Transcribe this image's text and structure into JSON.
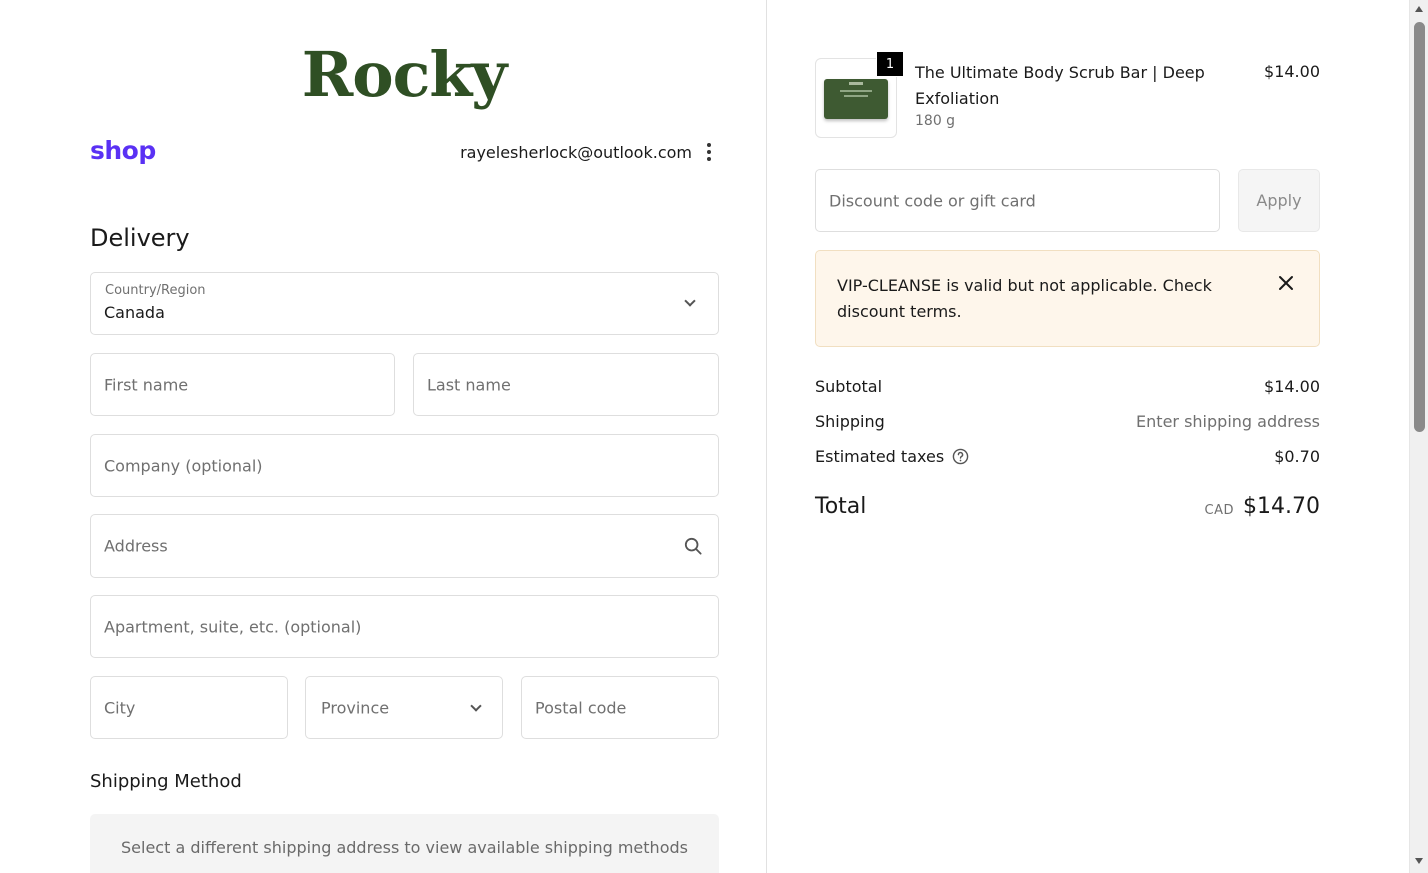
{
  "brand": {
    "logo_text": "Rocky",
    "shop_pay_text": "shop"
  },
  "account": {
    "email": "rayelesherlock@outlook.com"
  },
  "delivery": {
    "heading": "Delivery",
    "country_label": "Country/Region",
    "country_value": "Canada",
    "first_name_placeholder": "First name",
    "last_name_placeholder": "Last name",
    "company_placeholder": "Company (optional)",
    "address_placeholder": "Address",
    "apartment_placeholder": "Apartment, suite, etc. (optional)",
    "city_placeholder": "City",
    "province_placeholder": "Province",
    "postal_placeholder": "Postal code"
  },
  "shipping_method": {
    "heading": "Shipping Method",
    "note": "Select a different shipping address to view available shipping methods"
  },
  "cart": {
    "item": {
      "quantity": "1",
      "name": "The Ultimate Body Scrub Bar | Deep Exfoliation",
      "variant": "180 g",
      "price": "$14.00"
    },
    "discount_placeholder": "Discount code or gift card",
    "apply_label": "Apply",
    "notice_text": "VIP-CLEANSE is valid but not applicable. Check discount terms.",
    "summary": {
      "subtotal_label": "Subtotal",
      "subtotal_value": "$14.00",
      "shipping_label": "Shipping",
      "shipping_value": "Enter shipping address",
      "taxes_label": "Estimated taxes",
      "taxes_value": "$0.70",
      "total_label": "Total",
      "total_currency": "CAD",
      "total_value": "$14.70"
    }
  },
  "colors": {
    "brand_green": "#2f4f24",
    "shop_purple": "#5a31f4",
    "notice_bg": "#fef6eb"
  }
}
